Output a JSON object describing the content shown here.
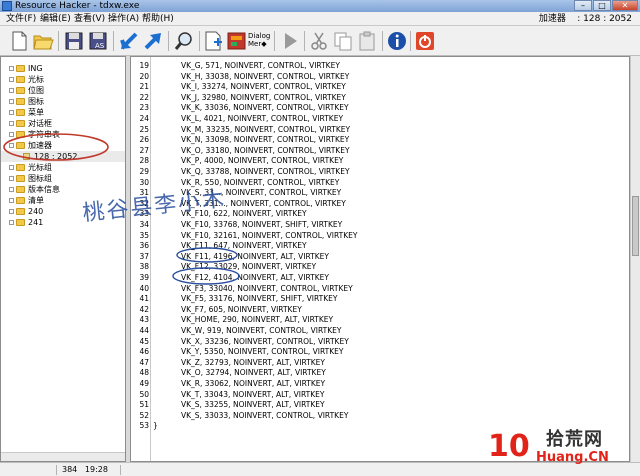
{
  "window": {
    "title": "Resource Hacker - tdxw.exe",
    "buttons": {
      "minimize": "–",
      "maximize": "□",
      "close": "✕"
    }
  },
  "menu": {
    "items": [
      "文件(F)",
      "编辑(E)",
      "查看(V)",
      "操作(A)",
      "帮助(H)"
    ],
    "status_right": "加速器    : 128 : 2052"
  },
  "toolbar": {
    "icons": [
      "new-icon",
      "open-icon",
      "save-icon",
      "save-as-icon",
      "arrow-left-icon",
      "arrow-right-icon",
      "search-icon",
      "add-resource-icon",
      "dialog-merger-icon",
      "play-icon",
      "cut-icon",
      "copy-icon",
      "paste-icon",
      "info-icon",
      "power-icon"
    ],
    "save_as_label": "AS",
    "dialog_merger_label": "Dialog Mer◆"
  },
  "tree": {
    "items": [
      {
        "label": "ING",
        "type": "folder"
      },
      {
        "label": "光标",
        "type": "folder"
      },
      {
        "label": "位图",
        "type": "folder"
      },
      {
        "label": "图标",
        "type": "folder"
      },
      {
        "label": "菜单",
        "type": "folder"
      },
      {
        "label": "对话框",
        "type": "folder"
      },
      {
        "label": "字符串表",
        "type": "folder"
      },
      {
        "label": "加速器",
        "type": "folder",
        "expanded": true
      },
      {
        "label": "128 : 2052",
        "type": "child"
      },
      {
        "label": "光标组",
        "type": "folder"
      },
      {
        "label": "图标组",
        "type": "folder"
      },
      {
        "label": "版本信息",
        "type": "folder"
      },
      {
        "label": "清单",
        "type": "folder"
      },
      {
        "label": "240",
        "type": "folder"
      },
      {
        "label": "241",
        "type": "folder"
      }
    ]
  },
  "editor": {
    "lines": [
      {
        "n": "19",
        "text": "VK_G, 571, NOINVERT, CONTROL, VIRTKEY"
      },
      {
        "n": "20",
        "text": "VK_H, 33038, NOINVERT, CONTROL, VIRTKEY"
      },
      {
        "n": "21",
        "text": "VK_I, 33274, NOINVERT, CONTROL, VIRTKEY"
      },
      {
        "n": "22",
        "text": "VK_J, 32980, NOINVERT, CONTROL, VIRTKEY"
      },
      {
        "n": "23",
        "text": "VK_K, 33036, NOINVERT, CONTROL, VIRTKEY"
      },
      {
        "n": "24",
        "text": "VK_L, 4021, NOINVERT, CONTROL, VIRTKEY"
      },
      {
        "n": "25",
        "text": "VK_M, 33235, NOINVERT, CONTROL, VIRTKEY"
      },
      {
        "n": "26",
        "text": "VK_N, 33098, NOINVERT, CONTROL, VIRTKEY"
      },
      {
        "n": "27",
        "text": "VK_O, 33180, NOINVERT, CONTROL, VIRTKEY"
      },
      {
        "n": "28",
        "text": "VK_P, 4000, NOINVERT, CONTROL, VIRTKEY"
      },
      {
        "n": "29",
        "text": "VK_Q, 33788, NOINVERT, CONTROL, VIRTKEY"
      },
      {
        "n": "30",
        "text": "VK_R, 550, NOINVERT, CONTROL, VIRTKEY"
      },
      {
        "n": "31",
        "text": "VK_S, 33..., NOINVERT, CONTROL, VIRTKEY"
      },
      {
        "n": "32",
        "text": "VK_T, 331..., NOINVERT, CONTROL, VIRTKEY"
      },
      {
        "n": "33",
        "text": "VK_F10, 622, NOINVERT, VIRTKEY"
      },
      {
        "n": "34",
        "text": "VK_F10, 33768, NOINVERT, SHIFT, VIRTKEY"
      },
      {
        "n": "35",
        "text": "VK_F10, 32161, NOINVERT, CONTROL, VIRTKEY"
      },
      {
        "n": "36",
        "text": "VK_F11, 647, NOINVERT, VIRTKEY"
      },
      {
        "n": "37",
        "text": "VK_F11, 4196, NOINVERT, ALT, VIRTKEY"
      },
      {
        "n": "38",
        "text": "VK_F12, 33029, NOINVERT, VIRTKEY"
      },
      {
        "n": "39",
        "text": "VK_F12, 4104, NOINVERT, ALT, VIRTKEY"
      },
      {
        "n": "40",
        "text": "VK_F3, 33040, NOINVERT, CONTROL, VIRTKEY"
      },
      {
        "n": "41",
        "text": "VK_F5, 33176, NOINVERT, SHIFT, VIRTKEY"
      },
      {
        "n": "42",
        "text": "VK_F7, 605, NOINVERT, VIRTKEY"
      },
      {
        "n": "43",
        "text": "VK_HOME, 290, NOINVERT, ALT, VIRTKEY"
      },
      {
        "n": "44",
        "text": "VK_W, 919, NOINVERT, CONTROL, VIRTKEY"
      },
      {
        "n": "45",
        "text": "VK_X, 33236, NOINVERT, CONTROL, VIRTKEY"
      },
      {
        "n": "46",
        "text": "VK_Y, 5350, NOINVERT, CONTROL, VIRTKEY"
      },
      {
        "n": "47",
        "text": "VK_Z, 32793, NOINVERT, ALT, VIRTKEY"
      },
      {
        "n": "48",
        "text": "VK_O, 32794, NOINVERT, ALT, VIRTKEY"
      },
      {
        "n": "49",
        "text": "VK_R, 33062, NOINVERT, ALT, VIRTKEY"
      },
      {
        "n": "50",
        "text": "VK_T, 33043, NOINVERT, ALT, VIRTKEY"
      },
      {
        "n": "51",
        "text": "VK_S, 33255, NOINVERT, ALT, VIRTKEY"
      },
      {
        "n": "52",
        "text": "VK_S, 33033, NOINVERT, CONTROL, VIRTKEY"
      },
      {
        "n": "53",
        "text": "}"
      }
    ]
  },
  "status": {
    "line": "384",
    "col": "19:28"
  },
  "annotation": {
    "handwritten_text": "桃谷县李小木",
    "color": "#2a4f9e",
    "circle_color": "#c0392b"
  },
  "watermark": {
    "brand": "10",
    "cn": "拾荒网",
    "url": "Huang.CN"
  },
  "colors": {
    "accent": "#3a7bd5",
    "annotation_red": "#c0392b",
    "annotation_blue": "#2a4f9e"
  }
}
